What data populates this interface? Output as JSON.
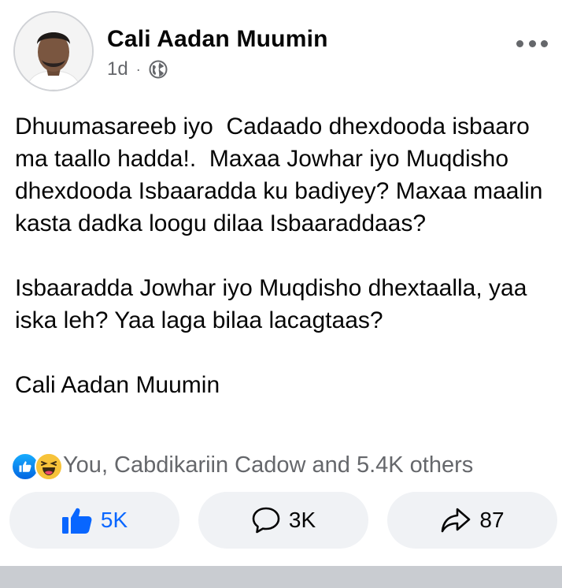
{
  "post": {
    "author": "Cali Aadan Muumin",
    "time": "1d",
    "separator": "·",
    "privacy_icon": "globe-icon",
    "more_icon": "more-horizontal-icon",
    "paragraphs": [
      "Dhuumasareeb iyo  Cadaado dhexdooda isbaaro ma taallo hadda!.  Maxaa Jowhar iyo Muqdisho dhexdooda Isbaaradda ku badiyey? Maxaa maalin kasta dadka loogu dilaa Isbaaraddaas?",
      "Isbaaradda Jowhar iyo Muqdisho dhextaalla, yaa iska leh? Yaa laga bilaa lacagtaas?",
      "Cali Aadan Muumin"
    ]
  },
  "reactions": {
    "icons": [
      "like-icon",
      "haha-icon"
    ],
    "summary": "You, Cabdikariin Cadow and 5.4K others"
  },
  "actions": {
    "like_count": "5K",
    "comment_count": "3K",
    "share_count": "87"
  },
  "colors": {
    "accent": "#0866ff",
    "secondary_text": "#65676b",
    "button_bg": "#f0f2f5"
  }
}
